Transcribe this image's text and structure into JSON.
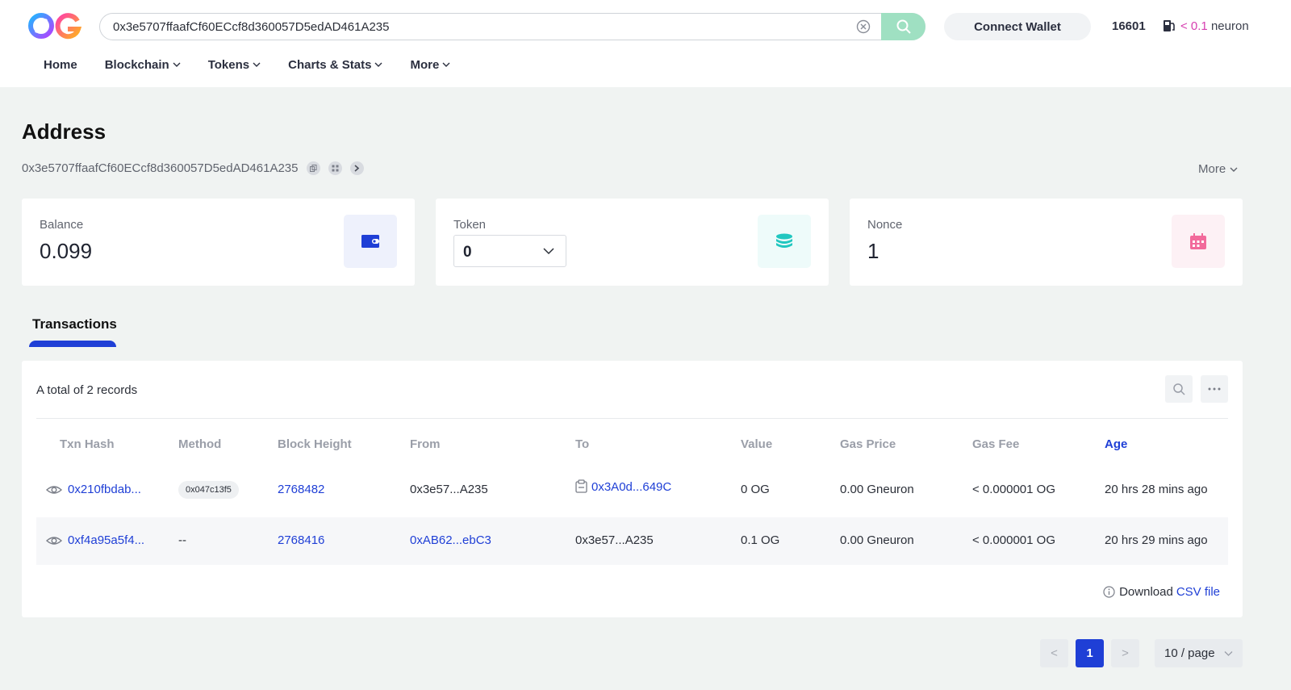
{
  "header": {
    "search_value": "0x3e5707ffaafCf60ECcf8d360057D5edAD461A235",
    "connect_wallet_label": "Connect Wallet",
    "block_number": "16601",
    "gas_prefix": "< 0.1",
    "gas_unit": " neuron"
  },
  "nav": {
    "items": [
      {
        "label": "Home"
      },
      {
        "label": "Blockchain"
      },
      {
        "label": "Tokens"
      },
      {
        "label": "Charts & Stats"
      },
      {
        "label": "More"
      }
    ]
  },
  "page": {
    "title": "Address",
    "address": "0x3e5707ffaafCf60ECcf8d360057D5edAD461A235",
    "more_label": "More"
  },
  "cards": {
    "balance": {
      "label": "Balance",
      "value": "0.099"
    },
    "token": {
      "label": "Token",
      "value": "0"
    },
    "nonce": {
      "label": "Nonce",
      "value": "1"
    }
  },
  "tabs": {
    "transactions_label": "Transactions"
  },
  "table": {
    "records_text": "A total of 2 records",
    "columns": [
      "Txn Hash",
      "Method",
      "Block Height",
      "From",
      "To",
      "Value",
      "Gas Price",
      "Gas Fee",
      "Age"
    ],
    "rows": [
      {
        "hash": "0x210fbdab...",
        "method": "0x047c13f5",
        "block": "2768482",
        "from": "0x3e57...A235",
        "to": "0x3A0d...649C",
        "value": "0 OG",
        "gas_price": "0.00 Gneuron",
        "gas_fee": "< 0.000001 OG",
        "age": "20 hrs 28 mins ago"
      },
      {
        "hash": "0xf4a95a5f4...",
        "method": "--",
        "block": "2768416",
        "from": "0xAB62...ebC3",
        "to": "0x3e57...A235",
        "value": "0.1 OG",
        "gas_price": "0.00 Gneuron",
        "gas_fee": "< 0.000001 OG",
        "age": "20 hrs 29 mins ago"
      }
    ],
    "download_label": "Download",
    "csv_label": "CSV file"
  },
  "pagination": {
    "current_page": "1",
    "prev_symbol": "<",
    "next_symbol": ">",
    "page_size": "10 / page"
  },
  "colors": {
    "accent": "#1f3fd6",
    "search_button": "#9fe0c2",
    "gas_highlight": "#d63fb0"
  }
}
